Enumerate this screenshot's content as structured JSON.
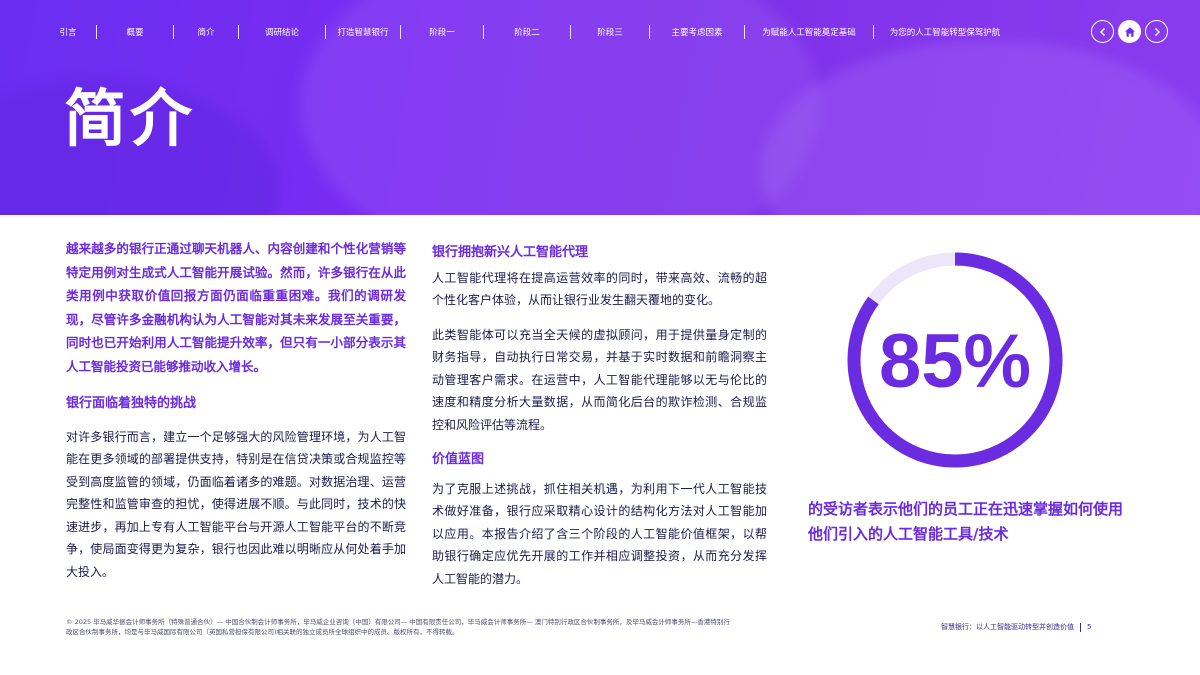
{
  "nav": {
    "items": [
      "引言",
      "概要",
      "简介",
      "调研结论",
      "打造智慧银行",
      "阶段一",
      "阶段二",
      "阶段三",
      "主要考虑因素",
      "为赋能人工智能奠定基础",
      "为您的人工智能转型保驾护航"
    ]
  },
  "hero": {
    "title": "简介"
  },
  "intro": {
    "lead": "越来越多的银行正通过聊天机器人、内容创建和个性化营销等特定用例对生成式人工智能开展试验。然而，许多银行在从此类用例中获取价值回报方面仍面临重重困难。我们的调研发现，尽管许多金融机构认为人工智能对其未来发展至关重要，同时也已开始利用人工智能提升效率，但只有一小部分表示其人工智能投资已能够推动收入增长。",
    "challenge_heading": "银行面临着独特的挑战",
    "challenge_text": "对许多银行而言，建立一个足够强大的风险管理环境，为人工智能在更多领域的部署提供支持，特别是在信贷决策或合规监控等受到高度监管的领域，仍面临着诸多的难题。对数据治理、运营完整性和监管审查的担忧，使得进展不顺。与此同时，技术的快速进步，再加上专有人工智能平台与开源人工智能平台的不断竞争，使局面变得更为复杂，银行也因此难以明晰应从何处着手加大投入。"
  },
  "agents": {
    "heading": "银行拥抱新兴人工智能代理",
    "p1": "人工智能代理将在提高运营效率的同时，带来高效、流畅的超个性化客户体验，从而让银行业发生翻天覆地的变化。",
    "p2": "此类智能体可以充当全天候的虚拟顾问，用于提供量身定制的财务指导，自动执行日常交易，并基于实时数据和前瞻洞察主动管理客户需求。在运营中，人工智能代理能够以无与伦比的速度和精度分析大量数据，从而简化后台的欺诈检测、合规监控和风险评估等流程。",
    "blueprint_heading": "价值蓝图",
    "blueprint_text": "为了克服上述挑战，抓住相关机遇，为利用下一代人工智能技术做好准备，银行应采取精心设计的结构化方法对人工智能加以应用。本报告介绍了含三个阶段的人工智能价值框架，以帮助银行确定应优先开展的工作并相应调整投资，从而充分发挥人工智能的潜力。"
  },
  "stat": {
    "value": "85%",
    "fraction": 0.85,
    "caption": "的受访者表示他们的员工正在迅速掌握如何使用他们引入的人工智能工具/技术",
    "accent_color": "#6b2be0"
  },
  "footer": {
    "legal": "© 2025 毕马威华振会计师事务所（特殊普通合伙）— 中国合伙制会计师事务所，毕马威企业咨询（中国）有限公司— 中国有限责任公司，毕马威会计师事务所— 澳门特别行政区合伙制事务所，及毕马威会计师事务所—香港特别行政区合伙制事务所，均是与毕马威国际有限公司（英国私营担保有限公司)相关联的独立成员所全球组织中的成员。版权所有，不得转载。",
    "report_title": "智慧银行：以人工智能驱动转型并创造价值",
    "page_number": "5"
  },
  "icons": {
    "prev": "chevron-left-icon",
    "home": "home-icon",
    "next": "chevron-right-icon"
  }
}
